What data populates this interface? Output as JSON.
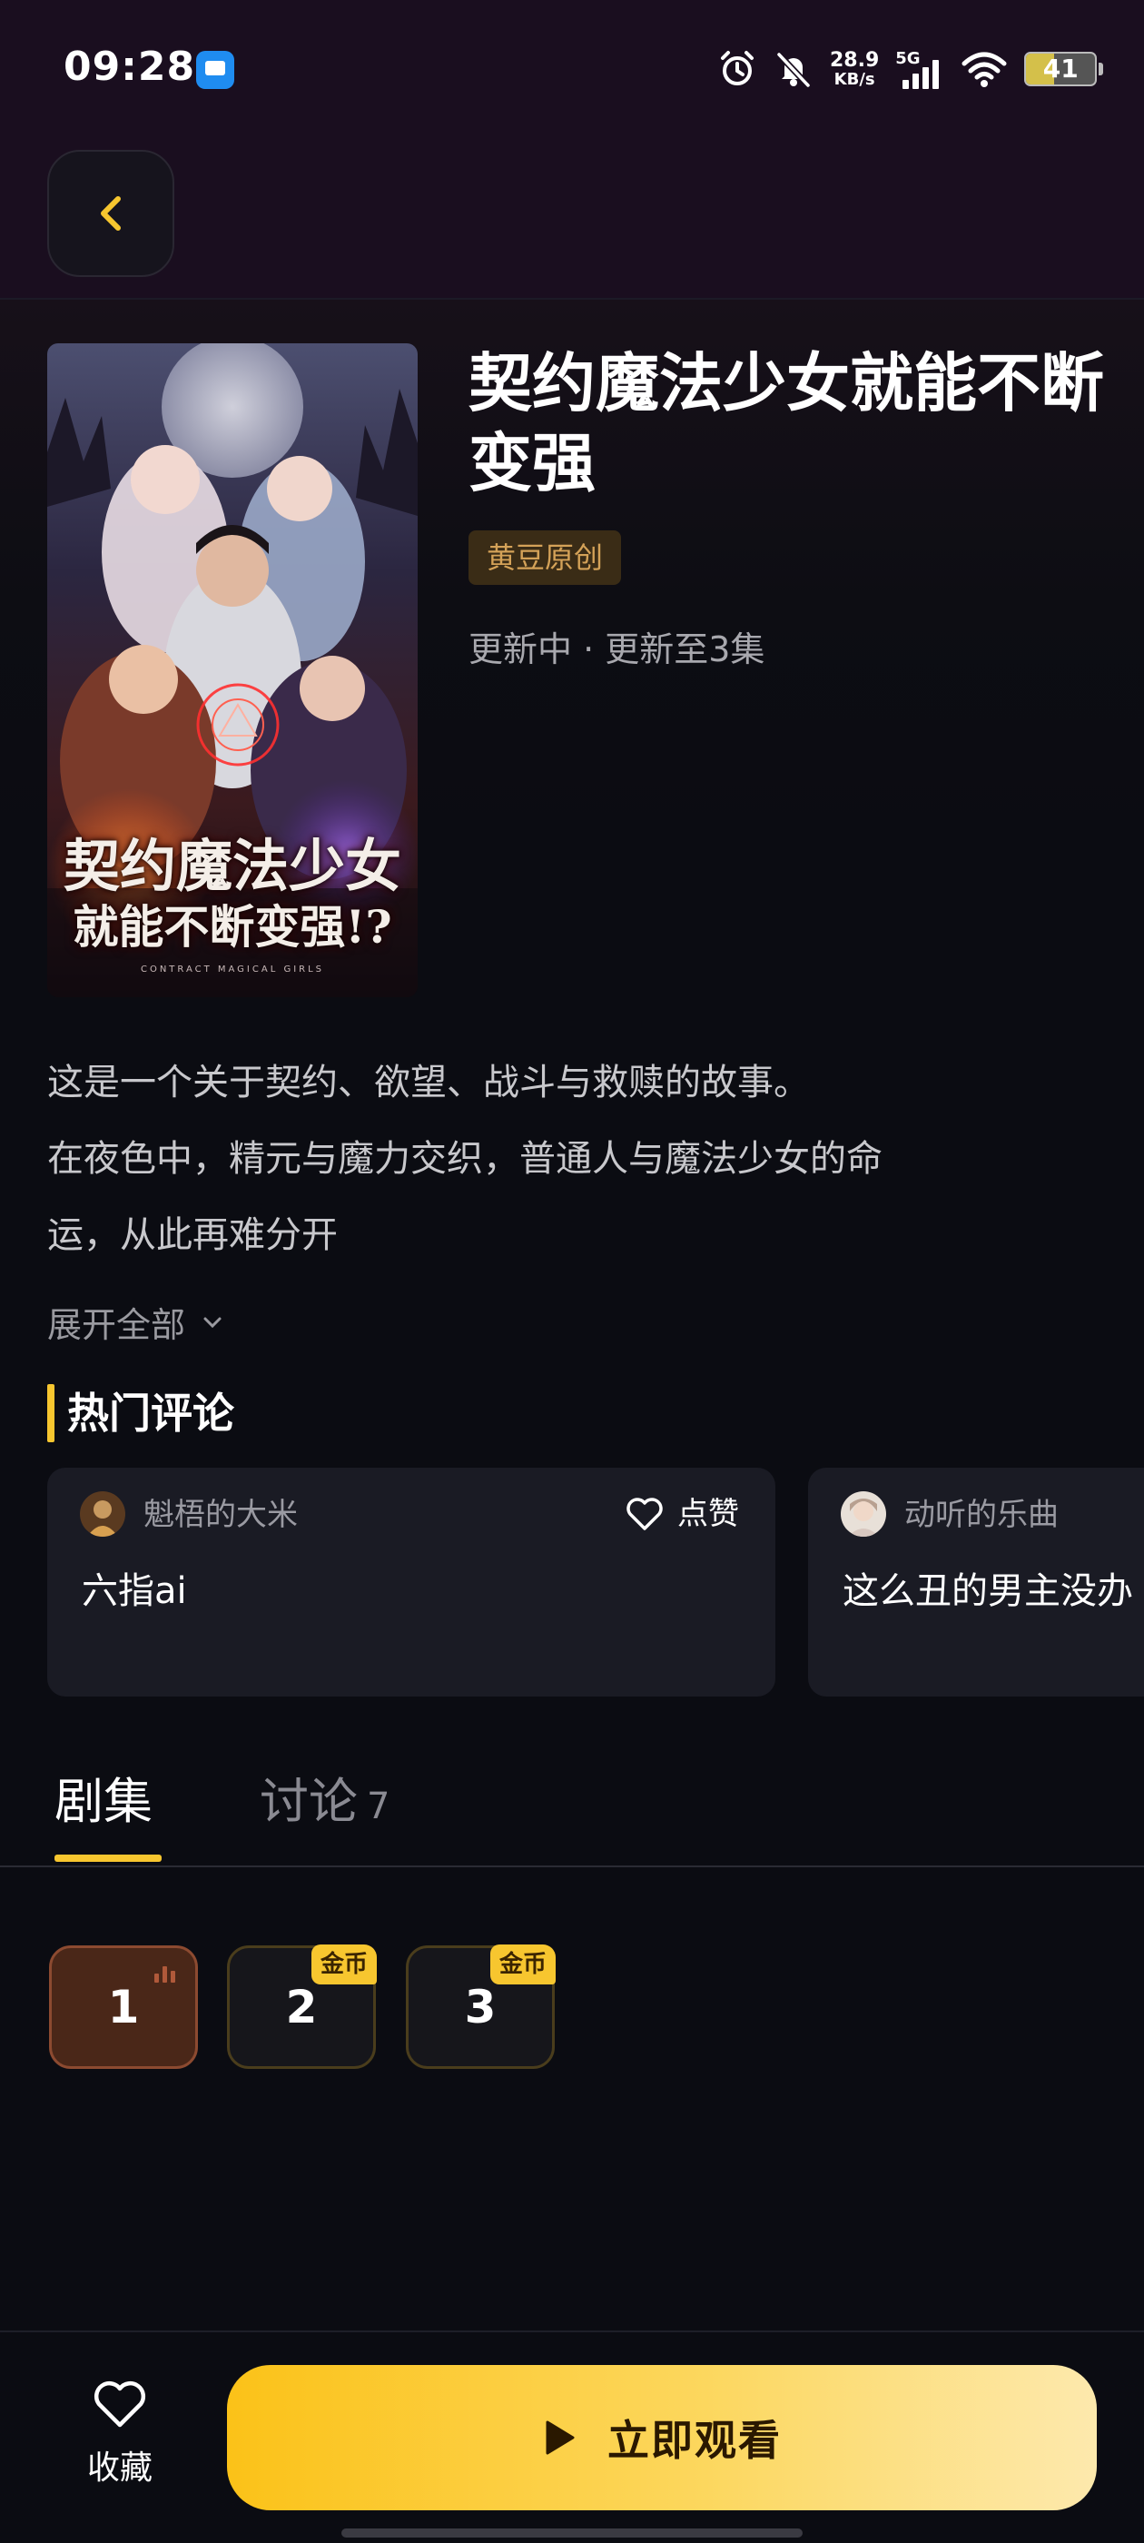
{
  "status_bar": {
    "time": "09:28",
    "net_speed_value": "28.9",
    "net_speed_unit": "KB/s",
    "network_type": "5G",
    "battery": "41",
    "battery_level": 0.41,
    "icons": [
      "app-notification-icon",
      "alarm-icon",
      "bell-muted-icon",
      "signal-icon",
      "wifi-icon",
      "battery-icon"
    ]
  },
  "header": {
    "back_icon": "chevron-left-icon"
  },
  "drama": {
    "poster": {
      "title_line1": "契约魔法少女",
      "title_line2": "就能不断变强!?",
      "subtitle": "CONTRACT MAGICAL GIRLS"
    },
    "title": "契约魔法少女就能不断变强",
    "tag": "黄豆原创",
    "status": "更新中 · 更新至3集",
    "description": [
      "这是一个关于契约、欲望、战斗与救赎的故事。",
      "在夜色中，精元与魔力交织，普通人与魔法少女的命",
      "运，从此再难分开"
    ],
    "expand_label": "展开全部"
  },
  "hot_comments": {
    "title": "热门评论",
    "like_label": "点赞",
    "items": [
      {
        "user": "魁梧的大米",
        "text": "六指ai"
      },
      {
        "user": "动听的乐曲",
        "text": "这么丑的男主没办"
      }
    ]
  },
  "tabs": [
    {
      "label": "剧集",
      "count": ""
    },
    {
      "label": "讨论",
      "count": "7"
    }
  ],
  "episodes": [
    {
      "number": "1",
      "badge": "",
      "playing": true
    },
    {
      "number": "2",
      "badge": "金币",
      "playing": false
    },
    {
      "number": "3",
      "badge": "金币",
      "playing": false
    }
  ],
  "bottom_bar": {
    "favorite_label": "收藏",
    "watch_label": "立即观看"
  },
  "colors": {
    "accent": "#f7c62f",
    "tag_bg": "#3a2c16",
    "tag_text": "#d4a258",
    "card_bg": "#1a1b24",
    "page_bg": "#0b0c12"
  }
}
